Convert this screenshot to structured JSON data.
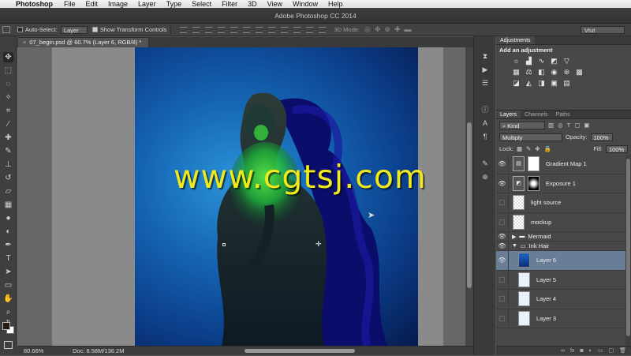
{
  "menubar": {
    "app_name": "Photoshop",
    "items": [
      "File",
      "Edit",
      "Image",
      "Layer",
      "Type",
      "Select",
      "Filter",
      "3D",
      "View",
      "Window",
      "Help"
    ]
  },
  "window": {
    "title": "Adobe Photoshop CC 2014"
  },
  "options": {
    "auto_select_label": "Auto-Select:",
    "auto_select_value": "Layer",
    "show_transform_label": "Show Transform Controls",
    "mode_label": "3D Mode:",
    "workspace": "Vtut"
  },
  "document": {
    "tab_title": "07_begin.psd @ 60.7% (Layer 6, RGB/8) *",
    "zoom": "60.66%",
    "doc_size": "Doc: 8.58M/136.2M"
  },
  "watermark": "www.cgtsj.com",
  "adjustments": {
    "tab": "Adjustments",
    "title": "Add an adjustment"
  },
  "layers_panel": {
    "tabs": [
      "Layers",
      "Channels",
      "Paths"
    ],
    "filter": "Kind",
    "blend_mode": "Multiply",
    "opacity_label": "Opacity:",
    "opacity_value": "100%",
    "lock_label": "Lock:",
    "fill_label": "Fill:",
    "fill_value": "100%",
    "layers": [
      {
        "name": "Gradient Map 1",
        "visible": true,
        "kind": "adjustment"
      },
      {
        "name": "Exposure 1",
        "visible": true,
        "kind": "adjustment"
      },
      {
        "name": "light source",
        "visible": false,
        "kind": "pixel"
      },
      {
        "name": "mockup",
        "visible": false,
        "kind": "pixel"
      },
      {
        "name": "Mermaid",
        "visible": true,
        "kind": "group"
      },
      {
        "name": "Ink Hair",
        "visible": true,
        "kind": "group-open"
      },
      {
        "name": "Layer 6",
        "visible": true,
        "kind": "pixel",
        "selected": true
      },
      {
        "name": "Layer 5",
        "visible": false,
        "kind": "pixel"
      },
      {
        "name": "Layer 4",
        "visible": false,
        "kind": "pixel"
      },
      {
        "name": "Layer 3",
        "visible": false,
        "kind": "pixel"
      }
    ],
    "footer_icons": [
      "link-icon",
      "fx-icon",
      "mask-icon",
      "adjustment-icon",
      "folder-icon",
      "new-layer-icon",
      "trash-icon"
    ]
  },
  "colors": {
    "accent_selected": "#6a7d97",
    "watermark": "#f0ea1c",
    "canvas_blue": "#1565b4",
    "figure_green": "#3dff3d"
  }
}
